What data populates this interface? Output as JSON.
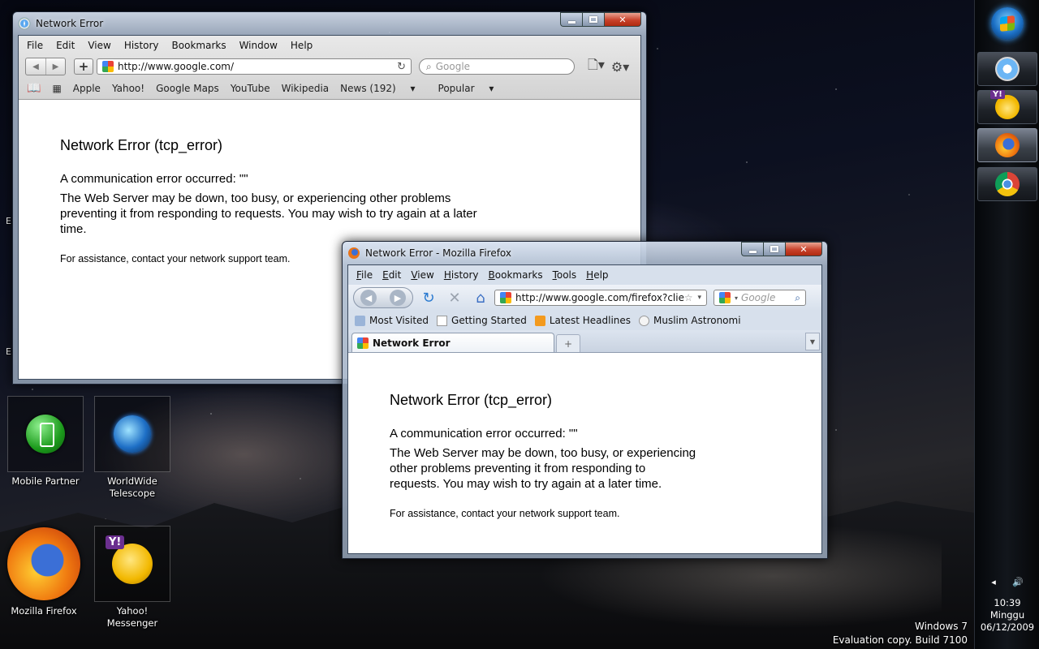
{
  "desktop": {
    "icons": [
      {
        "label": "Mobile Partner"
      },
      {
        "label": "WorldWide Telescope"
      },
      {
        "label": "Mozilla Firefox"
      },
      {
        "label": "Yahoo! Messenger"
      }
    ],
    "cut_labels": [
      "E",
      "E"
    ],
    "watermark": {
      "line1": "Windows 7",
      "line2": "Evaluation copy. Build 7100"
    }
  },
  "safari": {
    "title": "Network Error",
    "menu": [
      "File",
      "Edit",
      "View",
      "History",
      "Bookmarks",
      "Window",
      "Help"
    ],
    "url": "http://www.google.com/",
    "search_placeholder": "Google",
    "bookmarks": [
      "Apple",
      "Yahoo!",
      "Google Maps",
      "YouTube",
      "Wikipedia",
      "News (192)",
      "Popular"
    ],
    "page": {
      "heading": "Network Error (tcp_error)",
      "message": "A communication error occurred: \"\"",
      "body": "The Web Server may be down, too busy, or experiencing other problems preventing it from responding to requests. You may wish to try again at a later time.",
      "assist": "For assistance, contact your network support team."
    }
  },
  "firefox": {
    "title": "Network Error - Mozilla Firefox",
    "menu": [
      {
        "u": "F",
        "rest": "ile"
      },
      {
        "u": "E",
        "rest": "dit"
      },
      {
        "u": "V",
        "rest": "iew"
      },
      {
        "u": "H",
        "rest": "istory"
      },
      {
        "u": "B",
        "rest": "ookmarks"
      },
      {
        "u": "T",
        "rest": "ools"
      },
      {
        "u": "H",
        "rest": "elp"
      }
    ],
    "url": "http://www.google.com/firefox?clie",
    "search_placeholder": "Google",
    "bookmarks": [
      "Most Visited",
      "Getting Started",
      "Latest Headlines",
      "Muslim Astronomi"
    ],
    "tab_label": "Network Error",
    "page": {
      "heading": "Network Error (tcp_error)",
      "message": "A communication error occurred: \"\"",
      "body": "The Web Server may be down, too busy, or experiencing other problems preventing it from responding to requests. You may wish to try again at a later time.",
      "assist": "For assistance, contact your network support team."
    }
  },
  "taskbar": {
    "clock": {
      "time": "10:39",
      "day": "Minggu",
      "date": "06/12/2009"
    }
  }
}
